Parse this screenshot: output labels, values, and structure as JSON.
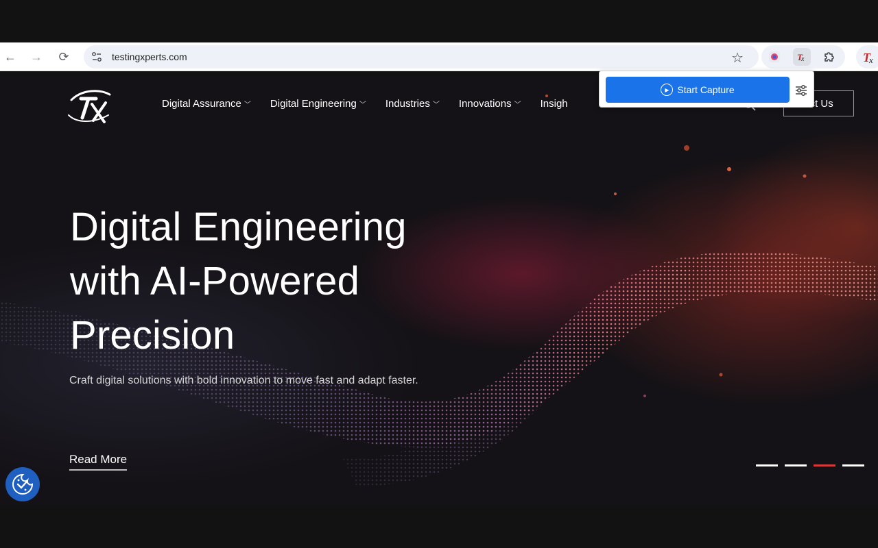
{
  "browser": {
    "url": "testingxperts.com",
    "back_icon": "←",
    "forward_icon": "→",
    "reload_icon": "⟳",
    "star_icon": "☆"
  },
  "extension_popup": {
    "start_capture_label": "Start Capture"
  },
  "site": {
    "nav": {
      "items": [
        {
          "label": "Digital Assurance"
        },
        {
          "label": "Digital Engineering"
        },
        {
          "label": "Industries"
        },
        {
          "label": "Innovations"
        },
        {
          "label": "Insigh"
        }
      ],
      "contact_label": "act Us"
    },
    "hero": {
      "title_line1": "Digital Engineering",
      "title_line2": "with AI-Powered",
      "title_line3": "Precision",
      "subtitle": "Craft digital solutions with bold innovation to move fast and adapt faster.",
      "read_more_label": "Read More"
    },
    "carousel": {
      "total": 4,
      "active_index": 3
    }
  },
  "colors": {
    "accent_blue": "#1a73e8",
    "active_dot": "#d33a3a",
    "background": "#141216"
  }
}
